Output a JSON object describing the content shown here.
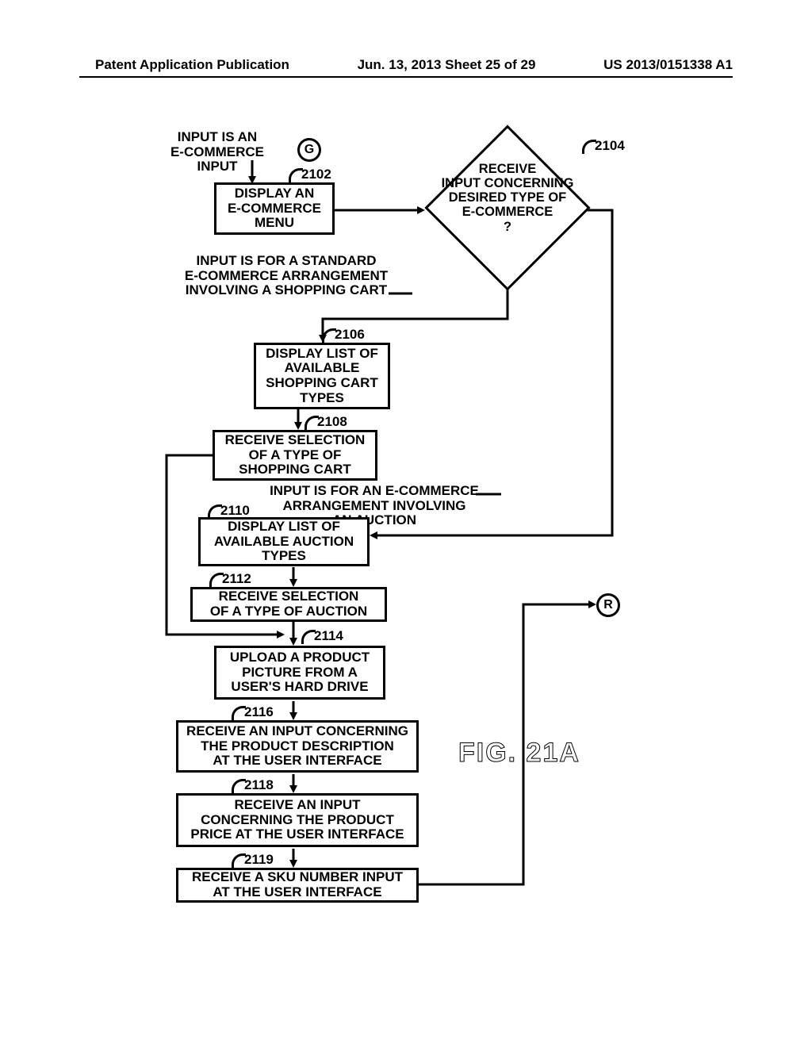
{
  "header": {
    "left": "Patent Application Publication",
    "center": "Jun. 13, 2013  Sheet 25 of 29",
    "right": "US 2013/0151338 A1"
  },
  "connectors": {
    "g": "G",
    "r": "R"
  },
  "labels": {
    "input_ecommerce": "INPUT IS AN\nE-COMMERCE\nINPUT",
    "input_standard": "INPUT IS FOR A STANDARD\nE-COMMERCE ARRANGEMENT\nINVOLVING A SHOPPING CART",
    "input_auction": "INPUT IS FOR AN E-COMMERCE\nARRANGEMENT INVOLVING\nAN AUCTION"
  },
  "boxes": {
    "b2102": "DISPLAY AN\nE-COMMERCE\nMENU",
    "b2104": "RECEIVE\nINPUT CONCERNING\nDESIRED TYPE OF\nE-COMMERCE\n?",
    "b2106": "DISPLAY LIST OF\nAVAILABLE\nSHOPPING CART\nTYPES",
    "b2108": "RECEIVE SELECTION\nOF A TYPE OF\nSHOPPING CART",
    "b2110": "DISPLAY LIST OF\nAVAILABLE AUCTION\nTYPES",
    "b2112": "RECEIVE SELECTION\nOF A TYPE OF AUCTION",
    "b2114": "UPLOAD A PRODUCT\nPICTURE FROM A\nUSER'S HARD DRIVE",
    "b2116": "RECEIVE AN INPUT CONCERNING\nTHE PRODUCT DESCRIPTION\nAT THE USER INTERFACE",
    "b2118": "RECEIVE AN INPUT\nCONCERNING THE PRODUCT\nPRICE AT THE USER INTERFACE",
    "b2119": "RECEIVE A SKU NUMBER INPUT\nAT THE USER INTERFACE"
  },
  "refs": {
    "r2102": "2102",
    "r2104": "2104",
    "r2106": "2106",
    "r2108": "2108",
    "r2110": "2110",
    "r2112": "2112",
    "r2114": "2114",
    "r2116": "2116",
    "r2118": "2118",
    "r2119": "2119"
  },
  "figure": "FIG. 21A",
  "chart_data": {
    "type": "flowchart",
    "title": "FIG. 21A",
    "nodes": [
      {
        "id": "G",
        "type": "connector",
        "label": "G"
      },
      {
        "id": "2102",
        "type": "process",
        "label": "DISPLAY AN E-COMMERCE MENU"
      },
      {
        "id": "2104",
        "type": "decision",
        "label": "RECEIVE INPUT CONCERNING DESIRED TYPE OF E-COMMERCE ?"
      },
      {
        "id": "2106",
        "type": "process",
        "label": "DISPLAY LIST OF AVAILABLE SHOPPING CART TYPES"
      },
      {
        "id": "2108",
        "type": "process",
        "label": "RECEIVE SELECTION OF A TYPE OF SHOPPING CART"
      },
      {
        "id": "2110",
        "type": "process",
        "label": "DISPLAY LIST OF AVAILABLE AUCTION TYPES"
      },
      {
        "id": "2112",
        "type": "process",
        "label": "RECEIVE SELECTION OF A TYPE OF AUCTION"
      },
      {
        "id": "2114",
        "type": "process",
        "label": "UPLOAD A PRODUCT PICTURE FROM A USER'S HARD DRIVE"
      },
      {
        "id": "2116",
        "type": "process",
        "label": "RECEIVE AN INPUT CONCERNING THE PRODUCT DESCRIPTION AT THE USER INTERFACE"
      },
      {
        "id": "2118",
        "type": "process",
        "label": "RECEIVE AN INPUT CONCERNING THE PRODUCT PRICE AT THE USER INTERFACE"
      },
      {
        "id": "2119",
        "type": "process",
        "label": "RECEIVE A SKU NUMBER INPUT AT THE USER INTERFACE"
      },
      {
        "id": "R",
        "type": "connector",
        "label": "R"
      }
    ],
    "edges": [
      {
        "from": "G",
        "to": "2102",
        "label": "INPUT IS AN E-COMMERCE INPUT"
      },
      {
        "from": "2102",
        "to": "2104"
      },
      {
        "from": "2104",
        "to": "2106",
        "label": "INPUT IS FOR A STANDARD E-COMMERCE ARRANGEMENT INVOLVING A SHOPPING CART"
      },
      {
        "from": "2104",
        "to": "2110",
        "label": "INPUT IS FOR AN E-COMMERCE ARRANGEMENT INVOLVING AN AUCTION"
      },
      {
        "from": "2106",
        "to": "2108"
      },
      {
        "from": "2108",
        "to": "2114"
      },
      {
        "from": "2110",
        "to": "2112"
      },
      {
        "from": "2112",
        "to": "2114"
      },
      {
        "from": "2114",
        "to": "2116"
      },
      {
        "from": "2116",
        "to": "2118"
      },
      {
        "from": "2118",
        "to": "2119"
      },
      {
        "from": "2119",
        "to": "R"
      }
    ]
  }
}
